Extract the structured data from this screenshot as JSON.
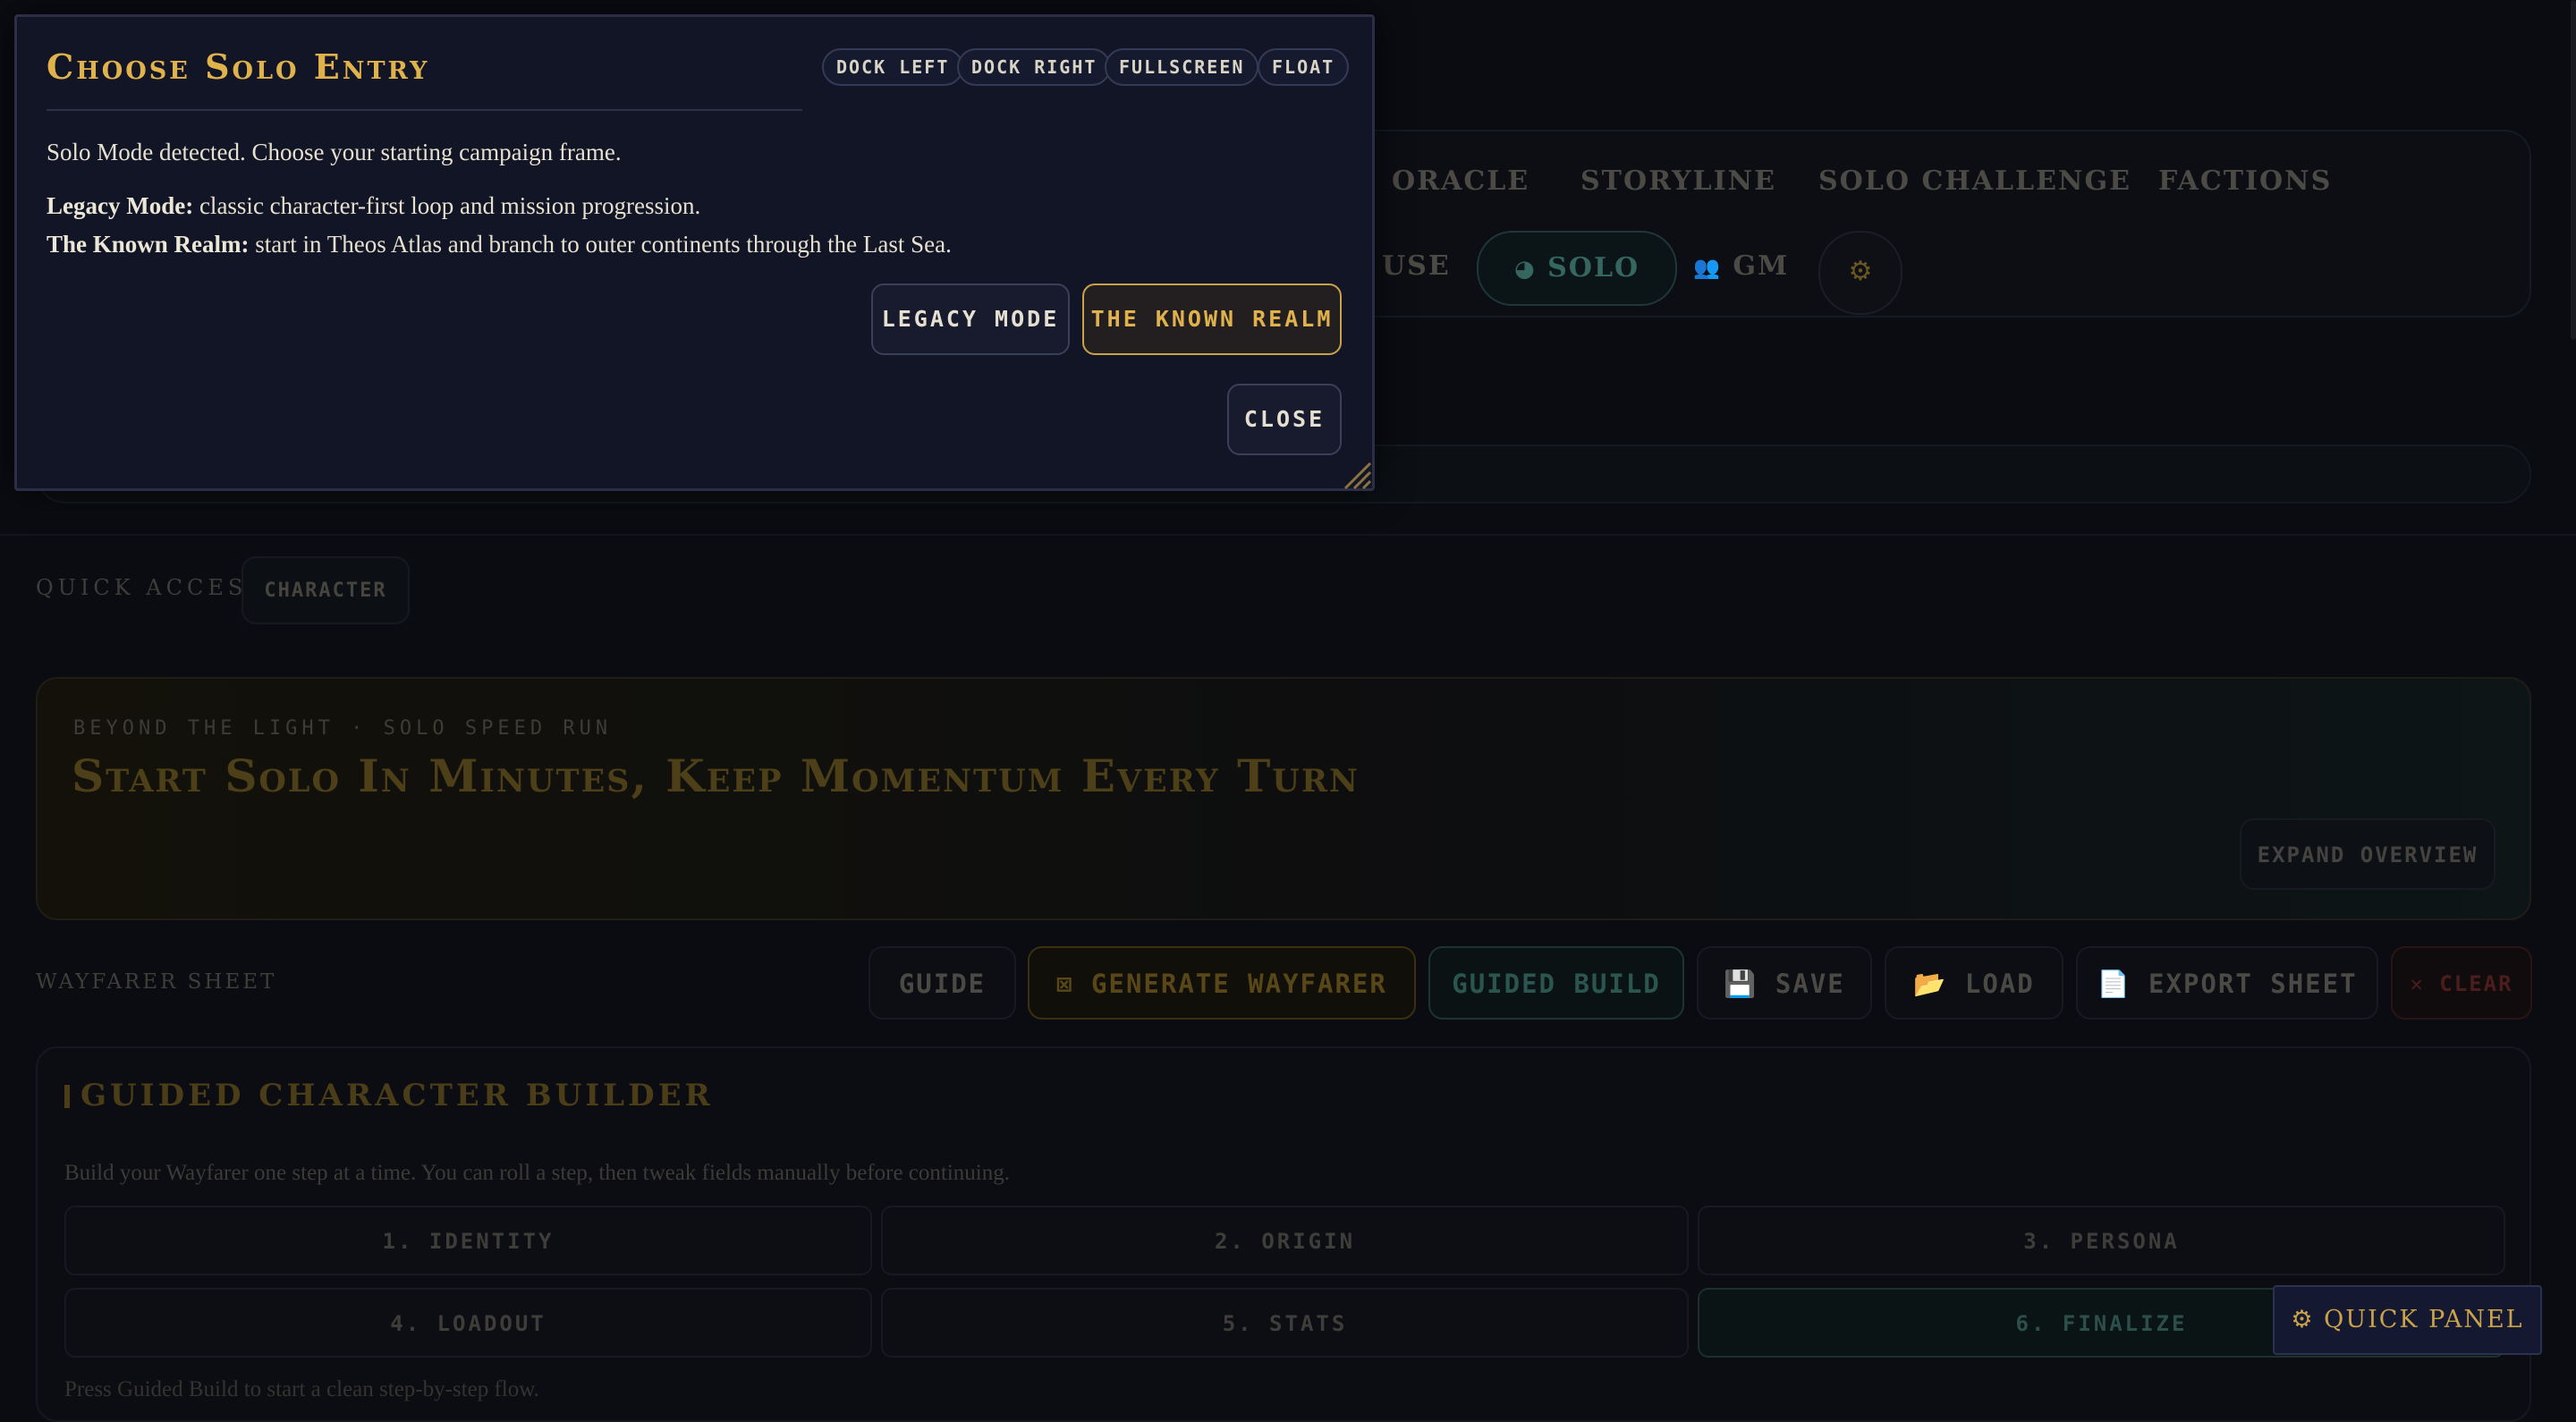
{
  "nav": {
    "tabs": [
      "ORACLE",
      "STORYLINE",
      "SOLO CHALLENGE",
      "FACTIONS"
    ],
    "modes": {
      "partial": "USE",
      "solo": "SOLO",
      "gm": "GM"
    },
    "icons": {
      "solo": "compass-icon",
      "gm": "users-icon",
      "settings": "gear-icon"
    }
  },
  "quick_access": {
    "label": "QUICK ACCESS",
    "chip": "CHARACTER"
  },
  "hero": {
    "kicker": "BEYOND THE LIGHT · SOLO SPEED RUN",
    "title": "Start Solo In Minutes, Keep Momentum Every Turn",
    "expand": "EXPAND OVERVIEW"
  },
  "sheet": {
    "label": "WAYFARER SHEET",
    "buttons": {
      "guide": "GUIDE",
      "generate": "⊠ GENERATE WAYFARER",
      "guided": "GUIDED BUILD",
      "save": "💾 SAVE",
      "load": "📂 LOAD",
      "export": "📄 EXPORT SHEET",
      "clear": "✕ CLEAR"
    }
  },
  "builder": {
    "title": "GUIDED CHARACTER BUILDER",
    "description": "Build your Wayfarer one step at a time. You can roll a step, then tweak fields manually before continuing.",
    "steps": [
      "1. IDENTITY",
      "2. ORIGIN",
      "3. PERSONA",
      "4. LOADOUT",
      "5. STATS",
      "6. FINALIZE"
    ],
    "footer": "Press Guided Build to start a clean step-by-step flow."
  },
  "quick_panel": "⚙ QUICK PANEL",
  "modal": {
    "title": "Choose Solo Entry",
    "dock": [
      "DOCK LEFT",
      "DOCK RIGHT",
      "FULLSCREEN",
      "FLOAT"
    ],
    "intro": "Solo Mode detected. Choose your starting campaign frame.",
    "legacy_label": "Legacy Mode:",
    "legacy_text": " classic character-first loop and mission progression.",
    "realm_label": "The Known Realm:",
    "realm_text": " start in Theos Atlas and branch to outer continents through the Last Sea.",
    "legacy_button": "LEGACY MODE",
    "realm_button": "THE KNOWN REALM",
    "close_button": "CLOSE"
  },
  "colors": {
    "accent": "#e0b24c",
    "modal_bg": "#121526",
    "page_bg": "#0a0c12",
    "teal": "#2b5650"
  }
}
